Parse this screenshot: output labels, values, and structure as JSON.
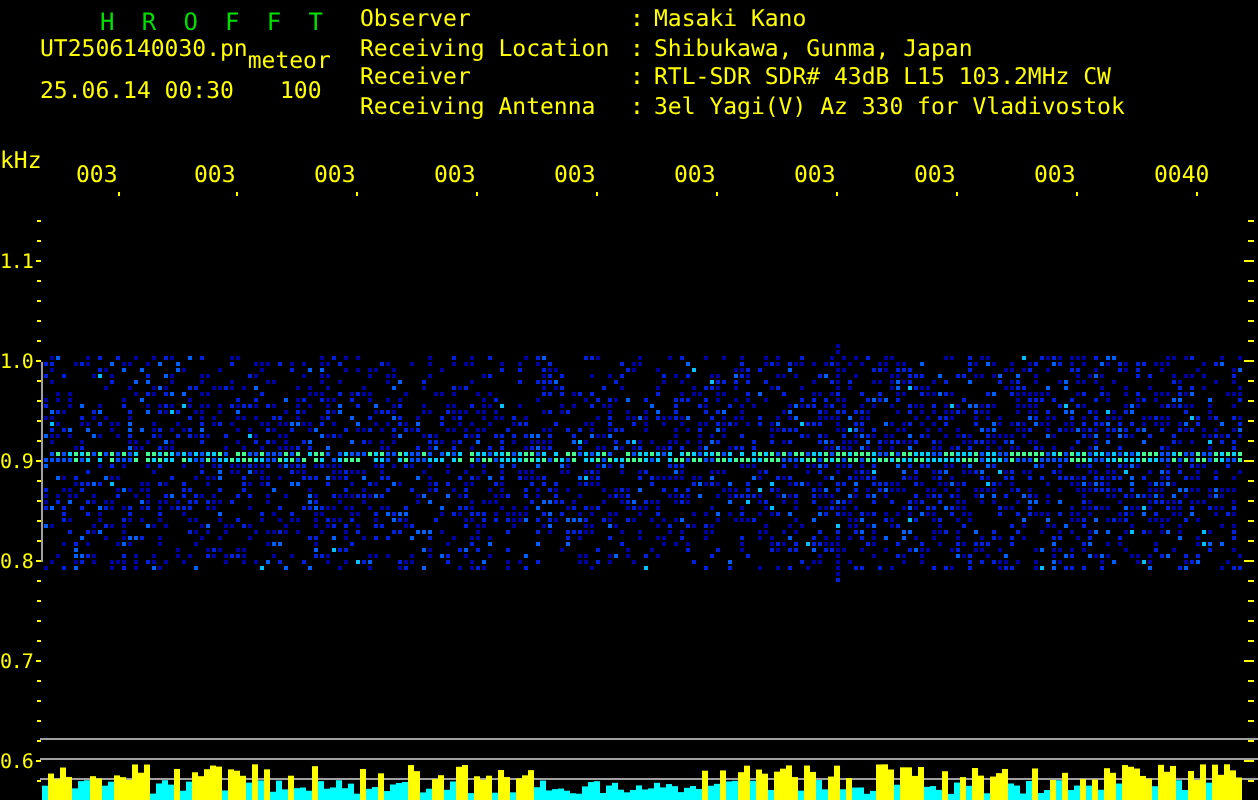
{
  "app_title": "H R O F F T",
  "file_name": "UT2506140030.pn",
  "mode": "meteor",
  "timestamp": "25.06.14 00:30",
  "count": "100",
  "info": [
    {
      "label": "Observer",
      "separator": ":",
      "value": "Masaki Kano"
    },
    {
      "label": "Receiving Location",
      "separator": ":",
      "value": "Shibukawa, Gunma, Japan"
    },
    {
      "label": "Receiver",
      "separator": ":",
      "value": "RTL-SDR SDR# 43dB L15 103.2MHz CW"
    },
    {
      "label": "Receiving Antenna",
      "separator": ":",
      "value": "3el Yagi(V) Az 330 for Vladivostok"
    }
  ],
  "frequency_unit": "kHz",
  "time_labels": [
    "003",
    "003",
    "003",
    "003",
    "003",
    "003",
    "003",
    "003",
    "003",
    "0040"
  ],
  "frequency_labels": [
    "1.1",
    "1.0",
    "0.9",
    "0.8",
    "0.7",
    "0.6"
  ]
}
